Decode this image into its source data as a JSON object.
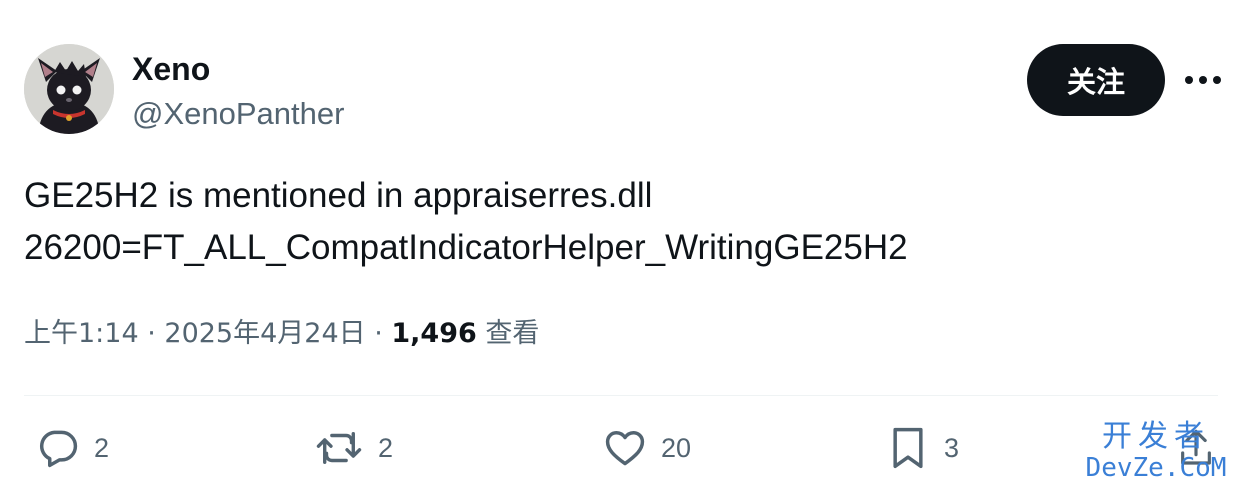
{
  "author": {
    "display_name": "Xeno",
    "handle": "@XenoPanther",
    "avatar_icon": "panther-avatar"
  },
  "header": {
    "follow_label": "关注",
    "more_icon": "more-horizontal-icon"
  },
  "tweet": {
    "lines": [
      "GE25H2 is mentioned in appraiserres.dll",
      "26200=FT_ALL_CompatIndicatorHelper_WritingGE25H2"
    ]
  },
  "meta": {
    "time": "上午1:14",
    "separator": " · ",
    "date": "2025年4月24日",
    "views_count": "1,496",
    "views_label": "查看"
  },
  "actions": {
    "reply": {
      "icon": "reply-icon",
      "count": "2"
    },
    "retweet": {
      "icon": "retweet-icon",
      "count": "2"
    },
    "like": {
      "icon": "heart-icon",
      "count": "20"
    },
    "bookmark": {
      "icon": "bookmark-icon",
      "count": "3"
    },
    "share": {
      "icon": "share-icon"
    }
  },
  "watermark": {
    "line1": "开发者",
    "line2": "DevZe.CoM"
  },
  "colors": {
    "text_primary": "#0f1419",
    "text_secondary": "#536471",
    "follow_bg": "#0f1419",
    "watermark": "#3a7fd6"
  }
}
